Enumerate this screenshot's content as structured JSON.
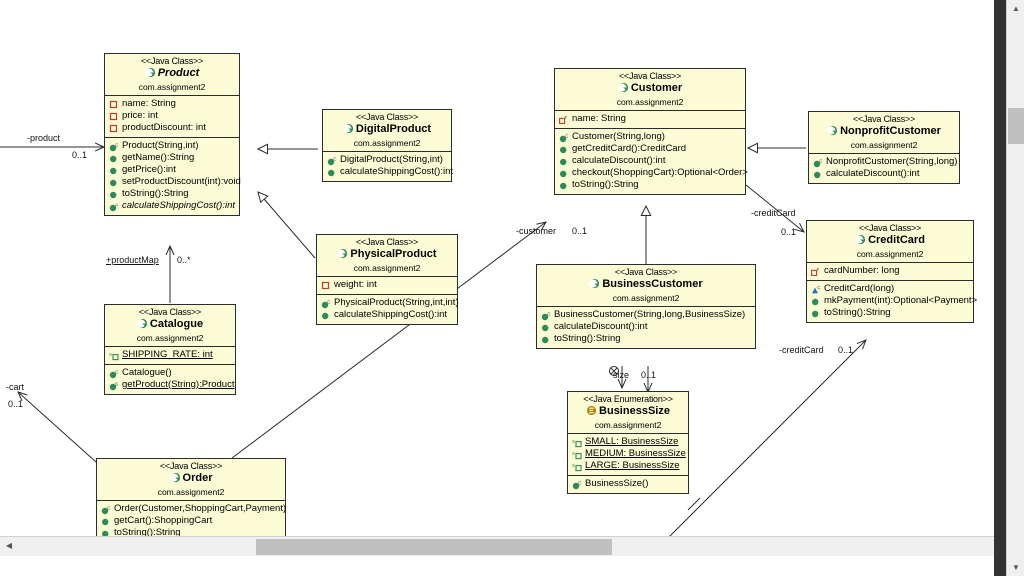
{
  "app": {
    "kind": "uml-class-diagram",
    "package": "com.assignment2",
    "stereotype_class": "<<Java Class>>",
    "stereotype_enum": "<<Java Enumeration>>",
    "background": "#ffffff",
    "box_fill": "#fbfbd6",
    "box_border": "#2b2b2b"
  },
  "classes": [
    {
      "id": "product",
      "stereotype": "<<Java Class>>",
      "name": "Product",
      "abstract": true,
      "package": "com.assignment2",
      "icon": "java-class-icon",
      "attributes": [
        {
          "text": "name: String",
          "marker": "private-field"
        },
        {
          "text": "price: int",
          "marker": "private-field"
        },
        {
          "text": "productDiscount: int",
          "marker": "private-field"
        }
      ],
      "methods": [
        {
          "text": "Product(String,int)",
          "marker": "constructor"
        },
        {
          "text": "getName():String",
          "marker": "public-method"
        },
        {
          "text": "getPrice():int",
          "marker": "public-method"
        },
        {
          "text": "setProductDiscount(int):void",
          "marker": "public-method"
        },
        {
          "text": "toString():String",
          "marker": "public-method"
        },
        {
          "text": "calculateShippingCost():int",
          "marker": "abstract-method",
          "italic": true
        }
      ]
    },
    {
      "id": "digitalproduct",
      "stereotype": "<<Java Class>>",
      "name": "DigitalProduct",
      "abstract": false,
      "package": "com.assignment2",
      "icon": "java-class-icon",
      "attributes": [],
      "methods": [
        {
          "text": "DigitalProduct(String,int)",
          "marker": "constructor"
        },
        {
          "text": "calculateShippingCost():int",
          "marker": "public-method"
        }
      ]
    },
    {
      "id": "physicalproduct",
      "stereotype": "<<Java Class>>",
      "name": "PhysicalProduct",
      "abstract": false,
      "package": "com.assignment2",
      "icon": "java-class-icon",
      "attributes": [
        {
          "text": "weight: int",
          "marker": "private-field"
        }
      ],
      "methods": [
        {
          "text": "PhysicalProduct(String,int,int)",
          "marker": "constructor"
        },
        {
          "text": "calculateShippingCost():int",
          "marker": "public-method"
        }
      ]
    },
    {
      "id": "catalogue",
      "stereotype": "<<Java Class>>",
      "name": "Catalogue",
      "abstract": false,
      "package": "com.assignment2",
      "icon": "java-class-icon",
      "attributes": [
        {
          "text": "SHIPPING_RATE: int",
          "marker": "static-field",
          "static": true
        }
      ],
      "methods": [
        {
          "text": "Catalogue()",
          "marker": "constructor"
        },
        {
          "text": "getProduct(String):Product",
          "marker": "static-method",
          "static": true
        }
      ]
    },
    {
      "id": "order",
      "stereotype": "<<Java Class>>",
      "name": "Order",
      "abstract": false,
      "package": "com.assignment2",
      "icon": "java-class-icon",
      "attributes": [],
      "methods": [
        {
          "text": "Order(Customer,ShoppingCart,Payment)",
          "marker": "constructor"
        },
        {
          "text": "getCart():ShoppingCart",
          "marker": "public-method"
        },
        {
          "text": "toString():String",
          "marker": "public-method"
        }
      ]
    },
    {
      "id": "customer",
      "stereotype": "<<Java Class>>",
      "name": "Customer",
      "abstract": false,
      "package": "com.assignment2",
      "icon": "java-class-icon",
      "attributes": [
        {
          "text": "name: String",
          "marker": "private-field"
        }
      ],
      "methods": [
        {
          "text": "Customer(String,long)",
          "marker": "constructor"
        },
        {
          "text": "getCreditCard():CreditCard",
          "marker": "public-method"
        },
        {
          "text": "calculateDiscount():int",
          "marker": "public-method"
        },
        {
          "text": "checkout(ShoppingCart):Optional<Order>",
          "marker": "public-method"
        },
        {
          "text": "toString():String",
          "marker": "public-method"
        }
      ]
    },
    {
      "id": "businesscustomer",
      "stereotype": "<<Java Class>>",
      "name": "BusinessCustomer",
      "abstract": false,
      "package": "com.assignment2",
      "icon": "java-class-icon",
      "attributes": [],
      "methods": [
        {
          "text": "BusinessCustomer(String,long,BusinessSize)",
          "marker": "constructor"
        },
        {
          "text": "calculateDiscount():int",
          "marker": "public-method"
        },
        {
          "text": "toString():String",
          "marker": "public-method"
        }
      ]
    },
    {
      "id": "nonprofitcustomer",
      "stereotype": "<<Java Class>>",
      "name": "NonprofitCustomer",
      "abstract": false,
      "package": "com.assignment2",
      "icon": "java-class-icon",
      "attributes": [],
      "methods": [
        {
          "text": "NonprofitCustomer(String,long)",
          "marker": "constructor"
        },
        {
          "text": "calculateDiscount():int",
          "marker": "public-method"
        }
      ]
    },
    {
      "id": "creditcard",
      "stereotype": "<<Java Class>>",
      "name": "CreditCard",
      "abstract": false,
      "package": "com.assignment2",
      "icon": "java-class-icon",
      "attributes": [
        {
          "text": "cardNumber: long",
          "marker": "private-field"
        }
      ],
      "methods": [
        {
          "text": "CreditCard(long)",
          "marker": "package-constructor"
        },
        {
          "text": "mkPayment(int):Optional<Payment>",
          "marker": "public-method"
        },
        {
          "text": "toString():String",
          "marker": "public-method"
        }
      ]
    },
    {
      "id": "businesssize",
      "stereotype": "<<Java Enumeration>>",
      "name": "BusinessSize",
      "abstract": false,
      "package": "com.assignment2",
      "icon": "java-enum-icon",
      "attributes": [
        {
          "text": "SMALL: BusinessSize",
          "marker": "static-field",
          "static": true
        },
        {
          "text": "MEDIUM: BusinessSize",
          "marker": "static-field",
          "static": true
        },
        {
          "text": "LARGE: BusinessSize",
          "marker": "static-field",
          "static": true
        }
      ],
      "methods": [
        {
          "text": "BusinessSize()",
          "marker": "constructor"
        }
      ]
    }
  ],
  "edge_labels": [
    {
      "id": "product-role",
      "text": "-product",
      "underline": false
    },
    {
      "id": "product-mult",
      "text": "0..1",
      "underline": false
    },
    {
      "id": "productmap-role",
      "text": "+productMap",
      "underline": true
    },
    {
      "id": "productmap-mult",
      "text": "0..*",
      "underline": false
    },
    {
      "id": "cart-role",
      "text": "-cart",
      "underline": false
    },
    {
      "id": "cart-mult",
      "text": "0..1",
      "underline": false
    },
    {
      "id": "customer-role",
      "text": "-customer",
      "underline": false
    },
    {
      "id": "customer-mult",
      "text": "0..1",
      "underline": false
    },
    {
      "id": "creditcard-role-1",
      "text": "-creditCard",
      "underline": false
    },
    {
      "id": "creditcard-mult-1",
      "text": "0..1",
      "underline": false
    },
    {
      "id": "creditcard-role-2",
      "text": "-creditCard",
      "underline": false
    },
    {
      "id": "creditcard-mult-2",
      "text": "0..1",
      "underline": false
    },
    {
      "id": "size-role",
      "text": "size",
      "underline": false
    },
    {
      "id": "size-mult",
      "text": "0..1",
      "underline": false
    }
  ],
  "scrollbars": {
    "vertical_up": "▲",
    "vertical_down": "▼",
    "horizontal_left": "◀",
    "horizontal_right": "▶"
  }
}
